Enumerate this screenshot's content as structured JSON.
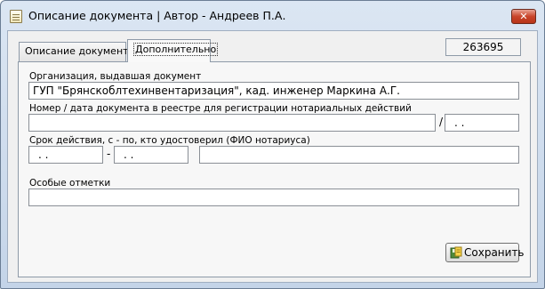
{
  "window": {
    "title": "Описание документа | Автор - Андреев П.А.",
    "close_symbol": "✕"
  },
  "tabs": [
    {
      "label": "Описание документа",
      "active": false
    },
    {
      "label": "Дополнительно",
      "active": true
    }
  ],
  "record_id": "263695",
  "form": {
    "organization": {
      "label": "Организация, выдавшая документ",
      "value": "ГУП \"Брянскоблтехинвентаризация\", кад. инженер Маркина А.Г."
    },
    "registry": {
      "label": "Номер / дата документа в реестре для регистрации нотариальных действий",
      "number_value": "",
      "separator": "/",
      "date_value": ". ."
    },
    "validity": {
      "label": "Срок действия, с - по, кто удостоверил (ФИО нотариуса)",
      "from_value": ". .",
      "separator": "-",
      "to_value": ". .",
      "notary_value": ""
    },
    "special_notes": {
      "label": "Особые отметки",
      "value": ""
    }
  },
  "buttons": {
    "save_label": "Сохранить"
  },
  "colors": {
    "titlebar": "#c4d4e8",
    "close_button": "#c9452b",
    "panel": "#f0f0f0"
  },
  "icons": {
    "app": "document-icon",
    "save": "save-icon"
  }
}
